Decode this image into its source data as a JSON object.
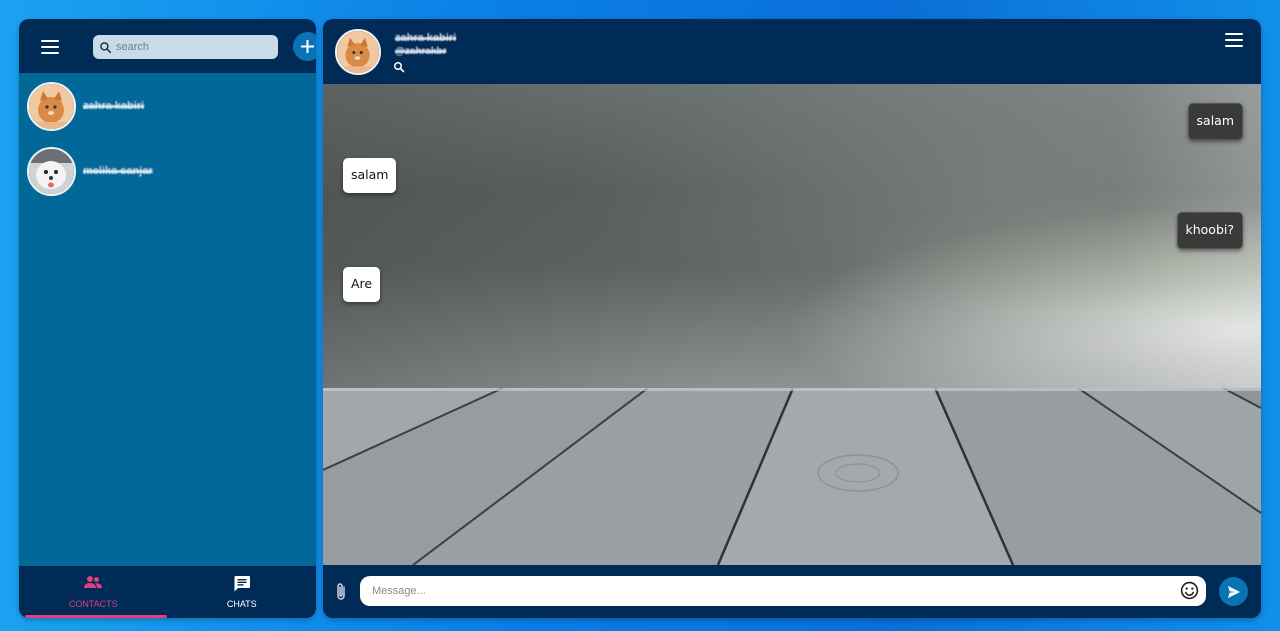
{
  "sidebar": {
    "menu_icon": "menu-icon",
    "search": {
      "placeholder": "search",
      "icon": "search-icon"
    },
    "add_icon": "plus-icon",
    "contacts": [
      {
        "name": "zahra kabiri",
        "avatar": "cat-avatar"
      },
      {
        "name": "melika sanjar",
        "avatar": "dog-avatar"
      }
    ],
    "tabs": [
      {
        "label": "CONTACTS",
        "icon": "people-icon",
        "active": true
      },
      {
        "label": "CHATS",
        "icon": "chat-icon",
        "active": false
      }
    ]
  },
  "chat": {
    "header": {
      "name": "zahra kabiri",
      "handle": "@zahrakbr",
      "avatar": "cat-avatar"
    },
    "messages": [
      {
        "text": "salam",
        "side": "out"
      },
      {
        "text": "salam",
        "side": "in"
      },
      {
        "text": "khoobi?",
        "side": "out"
      },
      {
        "text": "Are",
        "side": "in"
      }
    ],
    "composer": {
      "placeholder": "Message..."
    }
  },
  "colors": {
    "accent": "#e0407d",
    "dark": "#002b57",
    "panel": "#026898",
    "button": "#0a73b4"
  }
}
